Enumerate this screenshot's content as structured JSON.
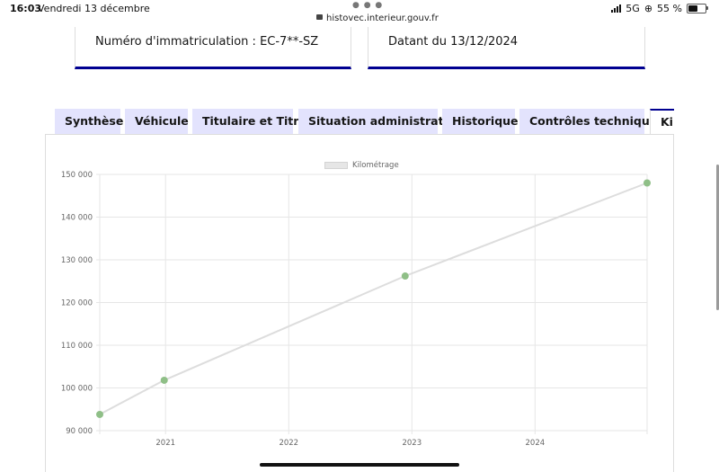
{
  "statusbar": {
    "time": "16:03",
    "date": "Vendredi 13 décembre",
    "url": "histovec.interieur.gouv.fr",
    "network": "5G",
    "battery": "55 %"
  },
  "cards": {
    "immatriculation": "Numéro d'immatriculation : EC-7**-SZ",
    "datant": "Datant du 13/12/2024"
  },
  "tabs": [
    {
      "label": "Synthèse"
    },
    {
      "label": "Véhicule"
    },
    {
      "label": "Titulaire et Titre"
    },
    {
      "label": "Situation administrative"
    },
    {
      "label": "Historique"
    },
    {
      "label": "Contrôles techniques"
    },
    {
      "label": "Kilométrage",
      "active": true
    }
  ],
  "colors": {
    "accent": "#000091",
    "tab_bg": "#e3e3fd",
    "line": "#dddddd",
    "point": "#8fbf87"
  },
  "chart_data": {
    "type": "line",
    "series": [
      {
        "name": "Kilométrage",
        "points": [
          {
            "x": "2020-06-20",
            "y": 93800
          },
          {
            "x": "2020-12-28",
            "y": 101800
          },
          {
            "x": "2022-12-12",
            "y": 126200
          },
          {
            "x": "2024-11-28",
            "y": 148000
          }
        ]
      }
    ],
    "yticks": [
      "90 000",
      "100 000",
      "110 000",
      "120 000",
      "130 000",
      "140 000",
      "150 000"
    ],
    "xticks": [
      "2021",
      "2022",
      "2023",
      "2024"
    ],
    "ylim": [
      90000,
      150000
    ],
    "xlim": [
      "2020-06-20",
      "2024-11-28"
    ],
    "grid": true,
    "legend": "top-center"
  }
}
